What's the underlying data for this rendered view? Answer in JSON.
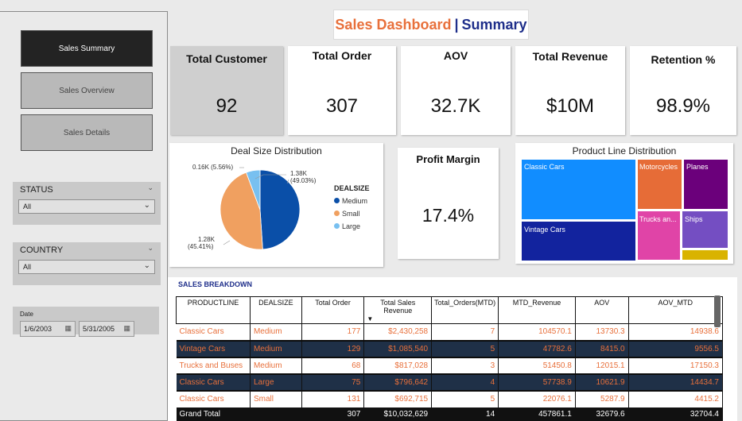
{
  "nav": {
    "sales_summary": "Sales Summary",
    "sales_overview": "Sales Overview",
    "sales_details": "Sales Details"
  },
  "filters": {
    "status": {
      "title": "STATUS",
      "value": "All"
    },
    "country": {
      "title": "COUNTRY",
      "value": "All"
    },
    "date": {
      "title": "Date",
      "start": "1/6/2003",
      "end": "5/31/2005"
    }
  },
  "header": {
    "part1": "Sales Dashboard",
    "separator": "|",
    "part2": "Summary"
  },
  "kpis": {
    "total_customer": {
      "label": "Total Customer",
      "value": "92"
    },
    "total_order": {
      "label": "Total Order",
      "value": "307"
    },
    "aov": {
      "label": "AOV",
      "value": "32.7K"
    },
    "total_revenue": {
      "label": "Total Revenue",
      "value": "$10M"
    },
    "retention": {
      "label": "Retention %",
      "value": "98.9%"
    },
    "profit_margin": {
      "label": "Profit Margin",
      "value": "17.4%"
    }
  },
  "chart_data": [
    {
      "type": "pie",
      "title": "Deal Size Distribution",
      "legend_title": "DEALSIZE",
      "legend_position": "right",
      "slices": [
        {
          "name": "Medium",
          "value": 1.38,
          "label": "1.38K",
          "pct": "(49.03%)",
          "color": "#0a4fa8"
        },
        {
          "name": "Small",
          "value": 1.28,
          "label": "1.28K",
          "pct": "(45.41%)",
          "color": "#f0a060"
        },
        {
          "name": "Large",
          "value": 0.16,
          "label": "0.16K",
          "pct": "(5.56%)",
          "color": "#78c0f0"
        }
      ]
    },
    {
      "type": "treemap",
      "title": "Product Line Distribution",
      "items": [
        {
          "name": "Classic Cars",
          "color": "#118dff"
        },
        {
          "name": "Vintage Cars",
          "color": "#12239e"
        },
        {
          "name": "Motorcycles",
          "color": "#e66c37"
        },
        {
          "name": "Planes",
          "color": "#6b007b"
        },
        {
          "name": "Trucks an...",
          "color": "#e044a7"
        },
        {
          "name": "Ships",
          "color": "#744ec2"
        },
        {
          "name": "",
          "color": "#d9b300"
        }
      ]
    }
  ],
  "table": {
    "title": "SALES  BREAKDOWN",
    "columns": [
      "PRODUCTLINE",
      "DEALSIZE",
      "Total Order",
      "Total Sales Revenue",
      "Total_Orders(MTD)",
      "MTD_Revenue",
      "AOV",
      "AOV_MTD"
    ],
    "rows": [
      [
        "Classic Cars",
        "Medium",
        "177",
        "$2,430,258",
        "7",
        "104570.1",
        "13730.3",
        "14938.6"
      ],
      [
        "Vintage Cars",
        "Medium",
        "129",
        "$1,085,540",
        "5",
        "47782.6",
        "8415.0",
        "9556.5"
      ],
      [
        "Trucks and Buses",
        "Medium",
        "68",
        "$817,028",
        "3",
        "51450.8",
        "12015.1",
        "17150.3"
      ],
      [
        "Classic Cars",
        "Large",
        "75",
        "$796,642",
        "4",
        "57738.9",
        "10621.9",
        "14434.7"
      ],
      [
        "Classic Cars",
        "Small",
        "131",
        "$692,715",
        "5",
        "22076.1",
        "5287.9",
        "4415.2"
      ]
    ],
    "total": [
      "Grand Total",
      "",
      "307",
      "$10,032,629",
      "14",
      "457861.1",
      "32679.6",
      "32704.4"
    ]
  }
}
